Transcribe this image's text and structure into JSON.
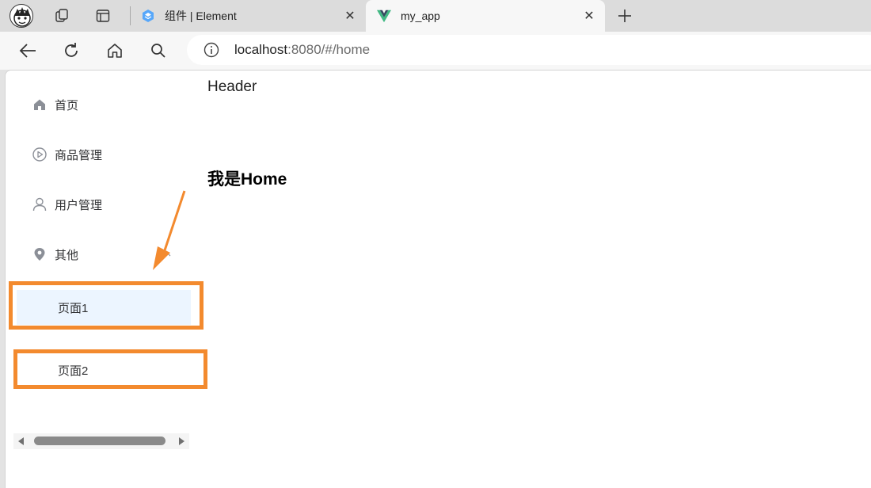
{
  "browser": {
    "tabs": [
      {
        "title": "组件 | Element",
        "active": false,
        "icon": "element-logo-icon"
      },
      {
        "title": "my_app",
        "active": true,
        "icon": "vue-logo-icon"
      }
    ],
    "address": {
      "host": "localhost",
      "rest": ":8080/#/home"
    }
  },
  "sidebar": {
    "items": [
      {
        "label": "首页",
        "icon": "home-icon"
      },
      {
        "label": "商品管理",
        "icon": "play-circle-icon"
      },
      {
        "label": "用户管理",
        "icon": "user-icon"
      },
      {
        "label": "其他",
        "icon": "location-icon",
        "expanded": true
      }
    ],
    "submenu": [
      {
        "label": "页面1",
        "active": true
      },
      {
        "label": "页面2",
        "active": false
      }
    ]
  },
  "main": {
    "header": "Header",
    "title": "我是Home"
  },
  "colors": {
    "annotation": "#f38a2e",
    "active_bg": "#ecf5ff",
    "vue_green": "#41b883"
  }
}
